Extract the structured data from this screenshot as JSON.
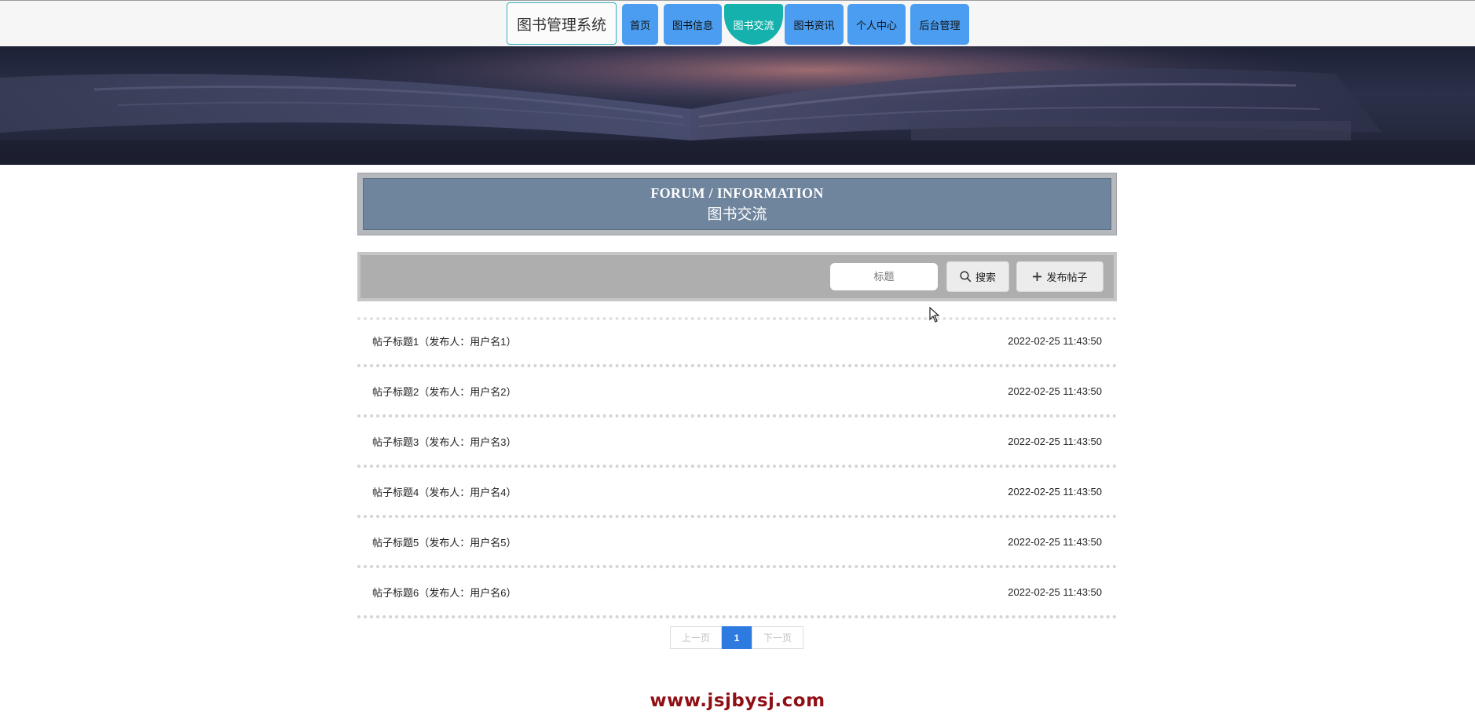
{
  "header": {
    "brand": "图书管理系统",
    "nav": [
      {
        "label": "首页",
        "active": false
      },
      {
        "label": "图书信息",
        "active": false
      },
      {
        "label": "图书交流",
        "active": true
      },
      {
        "label": "图书资讯",
        "active": false
      },
      {
        "label": "个人中心",
        "active": false
      },
      {
        "label": "后台管理",
        "active": false
      }
    ]
  },
  "section": {
    "title_en": "FORUM / INFORMATION",
    "title_zh": "图书交流"
  },
  "search": {
    "placeholder": "标题",
    "search_label": "搜索",
    "publish_label": "发布帖子",
    "search_icon": "search-icon",
    "publish_icon": "plus-icon"
  },
  "posts": [
    {
      "title": "帖子标题1（发布人：用户名1）",
      "time": "2022-02-25 11:43:50"
    },
    {
      "title": "帖子标题2（发布人：用户名2）",
      "time": "2022-02-25 11:43:50"
    },
    {
      "title": "帖子标题3（发布人：用户名3）",
      "time": "2022-02-25 11:43:50"
    },
    {
      "title": "帖子标题4（发布人：用户名4）",
      "time": "2022-02-25 11:43:50"
    },
    {
      "title": "帖子标题5（发布人：用户名5）",
      "time": "2022-02-25 11:43:50"
    },
    {
      "title": "帖子标题6（发布人：用户名6）",
      "time": "2022-02-25 11:43:50"
    }
  ],
  "pagination": {
    "prev": "上一页",
    "current": "1",
    "next": "下一页"
  },
  "footer": {
    "watermark": "www.jsjbysj.com"
  },
  "colors": {
    "nav": "#4a9df0",
    "nav_active": "#15b1ac",
    "title_panel": "#6f859d",
    "page_current": "#2d7be0",
    "watermark": "#8f0f14"
  }
}
